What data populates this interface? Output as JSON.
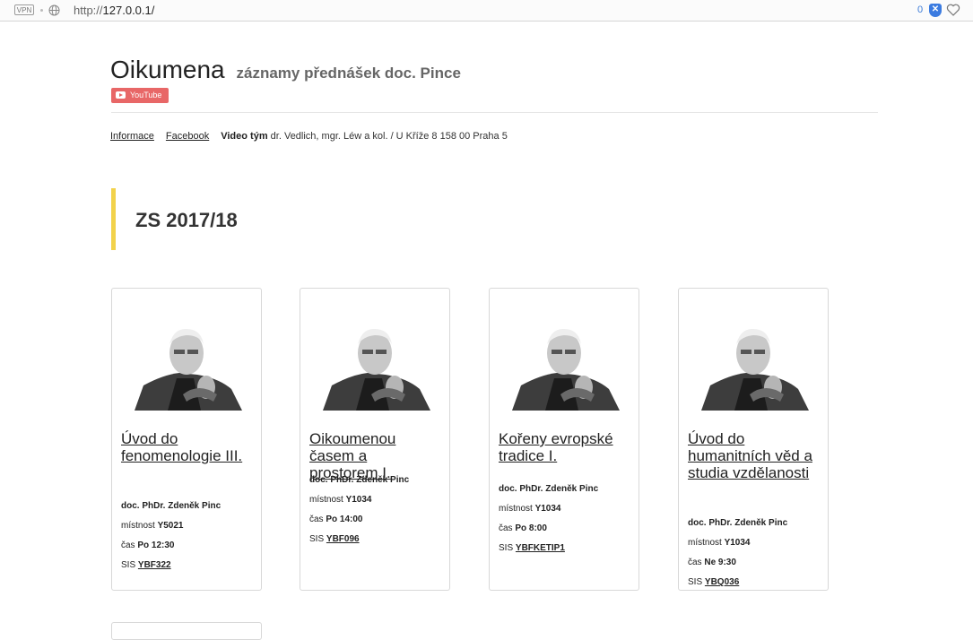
{
  "browser": {
    "vpn_label": "VPN",
    "url_scheme": "http://",
    "url_host": "127.0.0.1/",
    "tab_count": "0"
  },
  "header": {
    "title": "Oikumena",
    "subtitle": "záznamy přednášek doc. Pince",
    "youtube_badge": "YouTube"
  },
  "nav": {
    "informace": "Informace",
    "facebook": "Facebook",
    "team_label": "Video tým",
    "team_text": "dr. Vedlich, mgr. Léw a kol. / U Kříže 8 158 00 Praha 5"
  },
  "section": {
    "title": "ZS 2017/18"
  },
  "labels": {
    "room": "místnost",
    "time": "čas",
    "sis": "SIS"
  },
  "courses": [
    {
      "title": "Úvod do fenomenologie III.",
      "lecturer": "doc. PhDr. Zdeněk Pinc",
      "room": "Y5021",
      "time": "Po 12:30",
      "sis": "YBF322"
    },
    {
      "title": "Oikoumenou časem a prostorem I.",
      "lecturer": "doc. PhDr. Zdeněk Pinc",
      "room": "Y1034",
      "time": "Po 14:00",
      "sis": "YBF096"
    },
    {
      "title": "Kořeny evropské tradice I.",
      "lecturer": "doc. PhDr. Zdeněk Pinc",
      "room": "Y1034",
      "time": "Po 8:00",
      "sis": "YBFKETIP1"
    },
    {
      "title": "Úvod do humanitních věd a studia vzdělanosti",
      "lecturer": "doc. PhDr. Zdeněk Pinc",
      "room": "Y1034",
      "time": "Ne 9:30",
      "sis": "YBQ036"
    }
  ]
}
